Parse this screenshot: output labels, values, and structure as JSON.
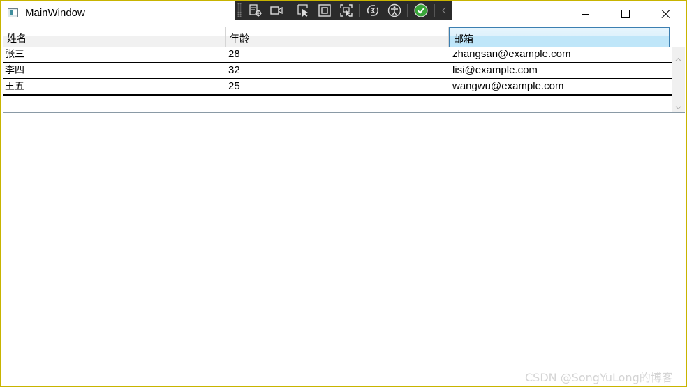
{
  "window": {
    "title": "MainWindow"
  },
  "toolbar": {
    "icons": [
      "select-element-icon",
      "video-camera-icon",
      "select-pointer-icon",
      "display-layout-adorners-icon",
      "track-focus-icon",
      "hot-reload-icon",
      "accessibility-icon",
      "checkmark-icon",
      "collapse-chevron-icon"
    ]
  },
  "grid": {
    "columns": [
      "姓名",
      "年龄",
      "邮箱"
    ],
    "active_column": 2,
    "rows": [
      {
        "name": "张三",
        "age": "28",
        "email": "zhangsan@example.com"
      },
      {
        "name": "李四",
        "age": "32",
        "email": "lisi@example.com"
      },
      {
        "name": "王五",
        "age": "25",
        "email": "wangwu@example.com"
      }
    ]
  },
  "watermark": "CSDN @SongYuLong的博客",
  "colors": {
    "border": "#c8b400",
    "header_active": "#bfe6f9",
    "toolbar_bg": "#2b2b2b",
    "check": "#3aa63a"
  }
}
